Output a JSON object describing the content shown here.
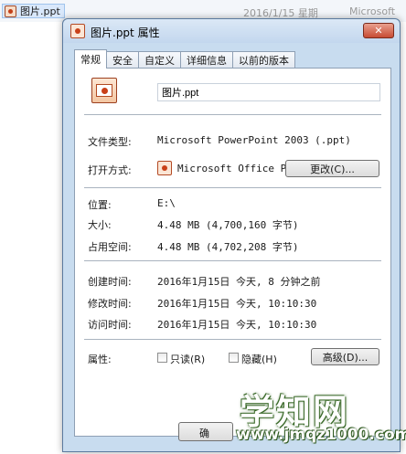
{
  "background": {
    "file_name": "图片.ppt",
    "date_partial": "2016/1/15 星期",
    "type_partial": "Microsoft"
  },
  "dialog": {
    "title": "图片.ppt 属性",
    "close_label": "✕",
    "tabs": [
      "常规",
      "安全",
      "自定义",
      "详细信息",
      "以前的版本"
    ],
    "file_name_value": "图片.ppt",
    "labels": {
      "file_type": "文件类型:",
      "open_with": "打开方式:",
      "location": "位置:",
      "size": "大小:",
      "size_on_disk": "占用空间:",
      "created": "创建时间:",
      "modified": "修改时间:",
      "accessed": "访问时间:",
      "attributes": "属性:"
    },
    "values": {
      "file_type": "Microsoft PowerPoint 2003 (.ppt)",
      "open_with": "Microsoft Office Po",
      "location": "E:\\",
      "size": "4.48 MB (4,700,160 字节)",
      "size_on_disk": "4.48 MB (4,702,208 字节)",
      "created": "2016年1月15日 今天, 8 分钟之前",
      "modified": "2016年1月15日 今天, 10:10:30",
      "accessed": "2016年1月15日 今天, 10:10:30"
    },
    "buttons": {
      "change": "更改(C)...",
      "advanced": "高级(D)...",
      "ok_partial": "确"
    },
    "attributes": {
      "readonly_label": "只读(R)",
      "hidden_label": "隐藏(H)"
    }
  },
  "watermark": {
    "big": "学知网",
    "small": "www.jmqz1000.com"
  }
}
